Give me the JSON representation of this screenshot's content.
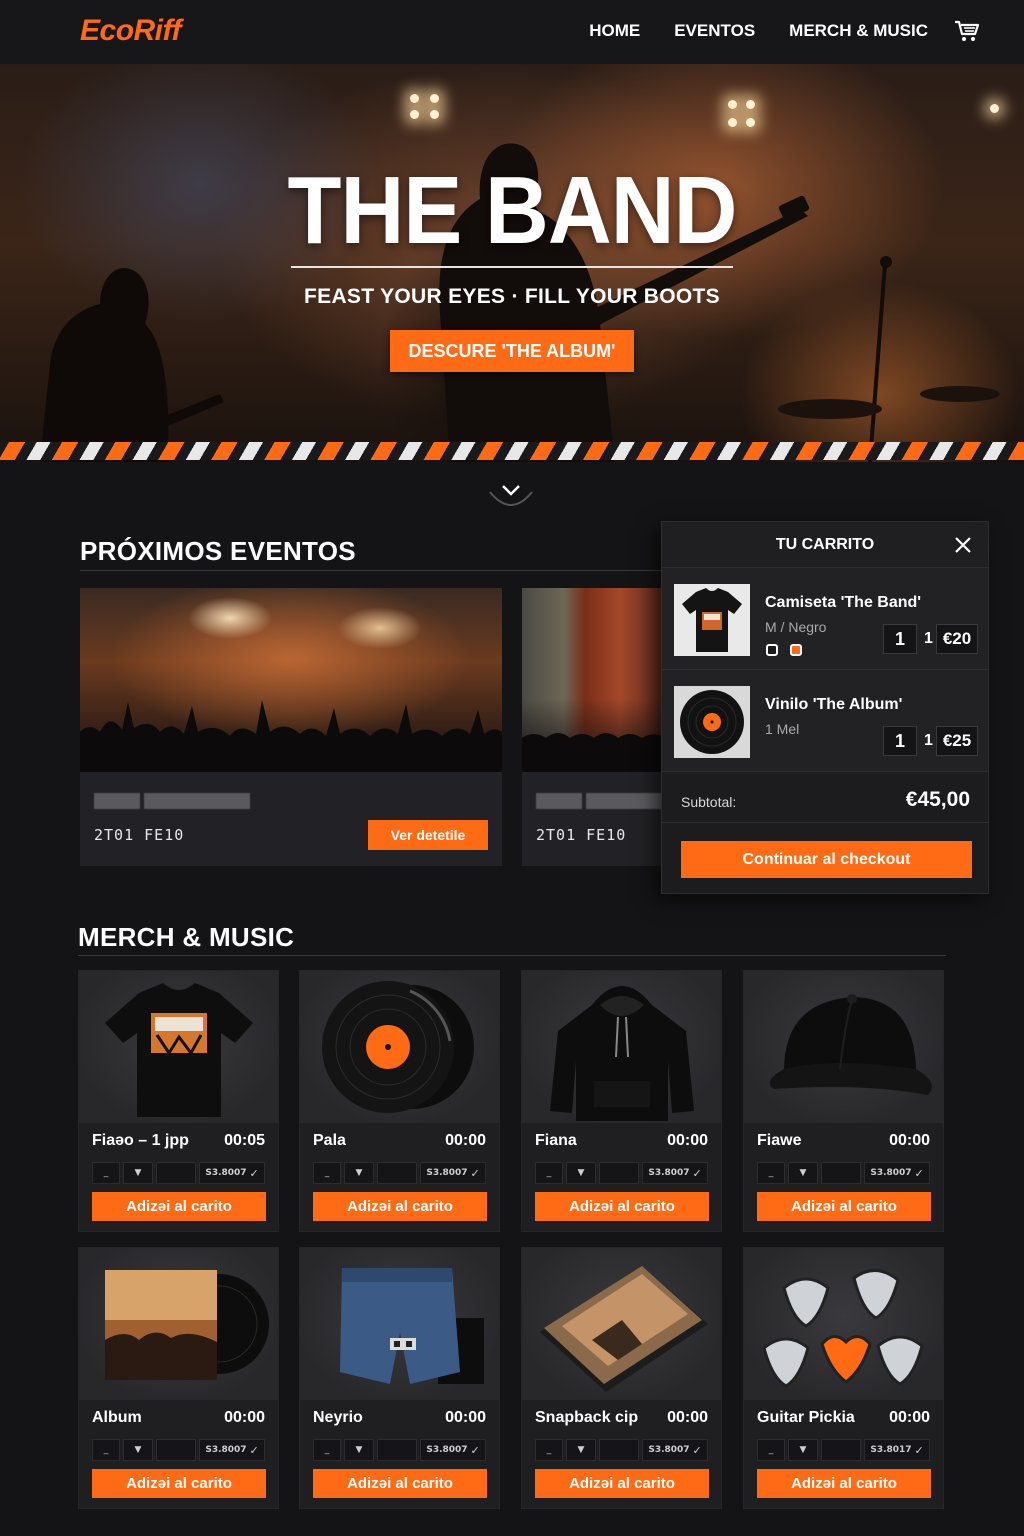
{
  "brand": {
    "logo": "EcoRiff",
    "accent": "#ff6a14"
  },
  "nav": {
    "links": [
      "HOME",
      "EVENTOS",
      "MERCH & MUSIC"
    ],
    "cart_icon": "cart-icon"
  },
  "hero": {
    "title": "THE BAND",
    "tagline": "FEAST YOUR EYES · FILL YOUR BOOTS",
    "cta": "DESCURE 'THE ALBUM'"
  },
  "events": {
    "title": "PRÓXIMOS EVENTOS",
    "cards": [
      {
        "date": "2T01 FE10",
        "button": "Ver detetile"
      },
      {
        "date": "2T01 FE10"
      }
    ]
  },
  "cart": {
    "title": "TU CARRITO",
    "items": [
      {
        "name": "Camiseta 'The Band'",
        "variant": "M / Negro",
        "qty": "1",
        "sep": "1",
        "price": "€20"
      },
      {
        "name": "Vinilo 'The Album'",
        "variant": "1 Mel",
        "qty": "1",
        "sep": "1",
        "price": "€25"
      }
    ],
    "subtotal_label": "Subtotal:",
    "subtotal_value": "€45,00",
    "checkout": "Continuar al checkout"
  },
  "merch": {
    "title": "MERCH & MUSIC",
    "products": [
      {
        "name": "Fiaəo – 1 jpp",
        "price": "00:05",
        "opt": "S3.8007",
        "button": "Adizəi al carito",
        "icon": "tshirt-icon"
      },
      {
        "name": "Pala",
        "price": "00:00",
        "opt": "S3.8007",
        "button": "Adizəi al carito",
        "icon": "vinyl-icon"
      },
      {
        "name": "Fiana",
        "price": "00:00",
        "opt": "S3.8007",
        "button": "Adizəi al carito",
        "icon": "hoodie-icon"
      },
      {
        "name": "Fiawe",
        "price": "00:00",
        "opt": "S3.8007",
        "button": "Adizəi al carito",
        "icon": "cap-icon"
      },
      {
        "name": "Album",
        "price": "00:00",
        "opt": "S3.8007",
        "button": "Adizəi al carito",
        "icon": "album-icon"
      },
      {
        "name": "Neyrio",
        "price": "00:00",
        "opt": "S3.8007",
        "button": "Adizəi al carito",
        "icon": "denim-shorts-icon"
      },
      {
        "name": "Snapback cip",
        "price": "00:00",
        "opt": "S3.8007",
        "button": "Adizəi al carito",
        "icon": "photobook-icon"
      },
      {
        "name": "Guitar Pickia",
        "price": "00:00",
        "opt": "S3.8017",
        "button": "Adizəi al carito",
        "icon": "guitar-picks-icon"
      }
    ]
  }
}
